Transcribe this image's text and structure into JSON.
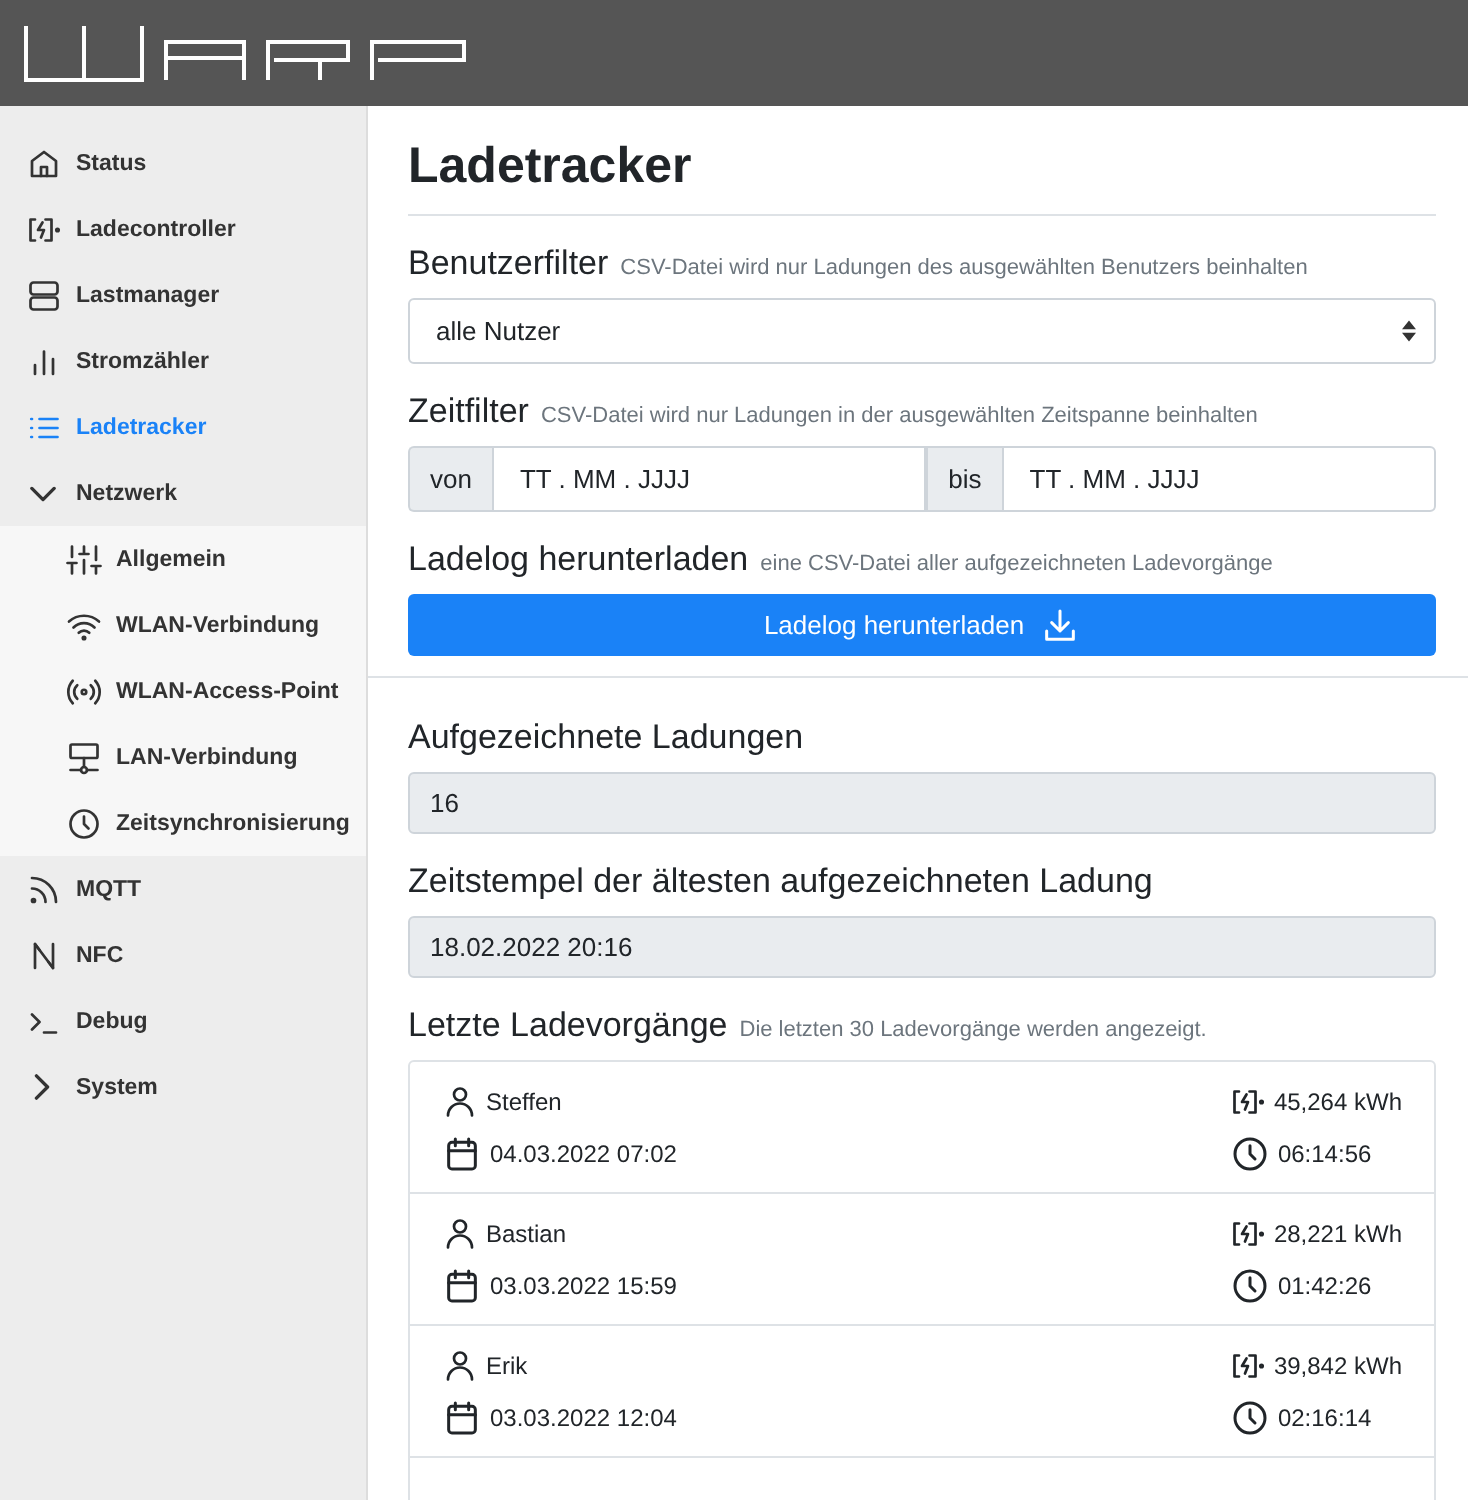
{
  "sidebar": {
    "items": [
      {
        "label": "Status",
        "selected": false
      },
      {
        "label": "Ladecontroller",
        "selected": false
      },
      {
        "label": "Lastmanager",
        "selected": false
      },
      {
        "label": "Stromzähler",
        "selected": false
      },
      {
        "label": "Ladetracker",
        "selected": true
      },
      {
        "label": "Netzwerk",
        "selected": false,
        "expanded": true,
        "children": [
          {
            "label": "Allgemein",
            "selected": false
          },
          {
            "label": "WLAN-Verbindung",
            "selected": false
          },
          {
            "label": "WLAN-Access-Point",
            "selected": false
          },
          {
            "label": "LAN-Verbindung",
            "selected": false
          },
          {
            "label": "Zeitsynchronisierung",
            "selected": false
          }
        ]
      },
      {
        "label": "MQTT",
        "selected": false
      },
      {
        "label": "NFC",
        "selected": false
      },
      {
        "label": "Debug",
        "selected": false
      },
      {
        "label": "System",
        "selected": false,
        "expanded": false
      }
    ]
  },
  "page": {
    "title": "Ladetracker",
    "user_filter": {
      "label": "Benutzerfilter",
      "hint": "CSV-Datei wird nur Ladungen des ausgewählten Benutzers beinhalten",
      "value": "alle Nutzer"
    },
    "time_filter": {
      "label": "Zeitfilter",
      "hint": "CSV-Datei wird nur Ladungen in der ausgewählten Zeitspanne beinhalten",
      "from_label": "von",
      "from_placeholder": "TT . MM . JJJJ",
      "to_label": "bis",
      "to_placeholder": "TT . MM . JJJJ"
    },
    "download": {
      "label": "Ladelog herunterladen",
      "hint": "eine CSV-Datei aller aufgezeichneten Ladevorgänge",
      "button": "Ladelog herunterladen"
    },
    "recorded": {
      "label": "Aufgezeichnete Ladungen",
      "value": "16"
    },
    "oldest": {
      "label": "Zeitstempel der ältesten aufgezeichneten Ladung",
      "value": "18.02.2022 20:16"
    },
    "recent": {
      "label": "Letzte Ladevorgänge",
      "hint": "Die letzten 30 Ladevorgänge werden angezeigt.",
      "charges": [
        {
          "user": "Steffen",
          "date": "04.03.2022 07:02",
          "energy": "45,264 kWh",
          "duration": "06:14:56"
        },
        {
          "user": "Bastian",
          "date": "03.03.2022 15:59",
          "energy": "28,221 kWh",
          "duration": "01:42:26"
        },
        {
          "user": "Erik",
          "date": "03.03.2022 12:04",
          "energy": "39,842 kWh",
          "duration": "02:16:14"
        }
      ]
    }
  }
}
